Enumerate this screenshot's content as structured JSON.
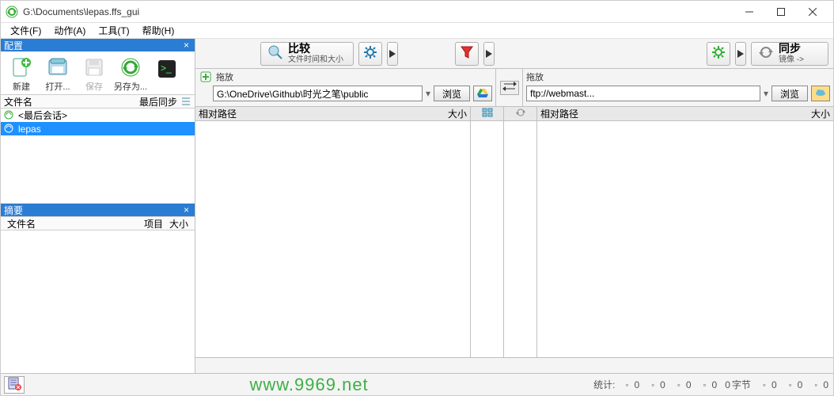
{
  "titlebar": {
    "path": "G:\\Documents\\lepas.ffs_gui"
  },
  "menu": {
    "file": "文件(F)",
    "actions": "动作(A)",
    "tools": "工具(T)",
    "help": "帮助(H)"
  },
  "left": {
    "config_title": "配置",
    "overview_title": "摘要",
    "toolbar": {
      "new": "新建",
      "open": "打开...",
      "save": "保存",
      "saveas": "另存为..."
    },
    "files_header": {
      "name": "文件名",
      "last_sync": "最后同步"
    },
    "files": [
      {
        "name": "<最后会话>",
        "selected": false,
        "icon": "recycle"
      },
      {
        "name": "lepas",
        "selected": true,
        "icon": "recycle"
      }
    ],
    "overview_header": {
      "name": "文件名",
      "items": "项目",
      "size": "大小"
    }
  },
  "actions": {
    "compare": {
      "title": "比较",
      "subtitle": "文件时间和大小"
    },
    "sync": {
      "title": "同步",
      "subtitle": "镜像 ->"
    }
  },
  "paths": {
    "drag_label": "拖放",
    "browse": "浏览",
    "left_value": "G:\\OneDrive\\Github\\时光之笔\\public",
    "right_value": "ftp://webmast..."
  },
  "list": {
    "rel_path": "相对路径",
    "size": "大小"
  },
  "status": {
    "stats_label": "统计:",
    "bytes_label": "字节",
    "counts": [
      "0",
      "0",
      "0",
      "0",
      "0",
      "0",
      "0",
      "0"
    ]
  },
  "watermark": "www.9969.net"
}
